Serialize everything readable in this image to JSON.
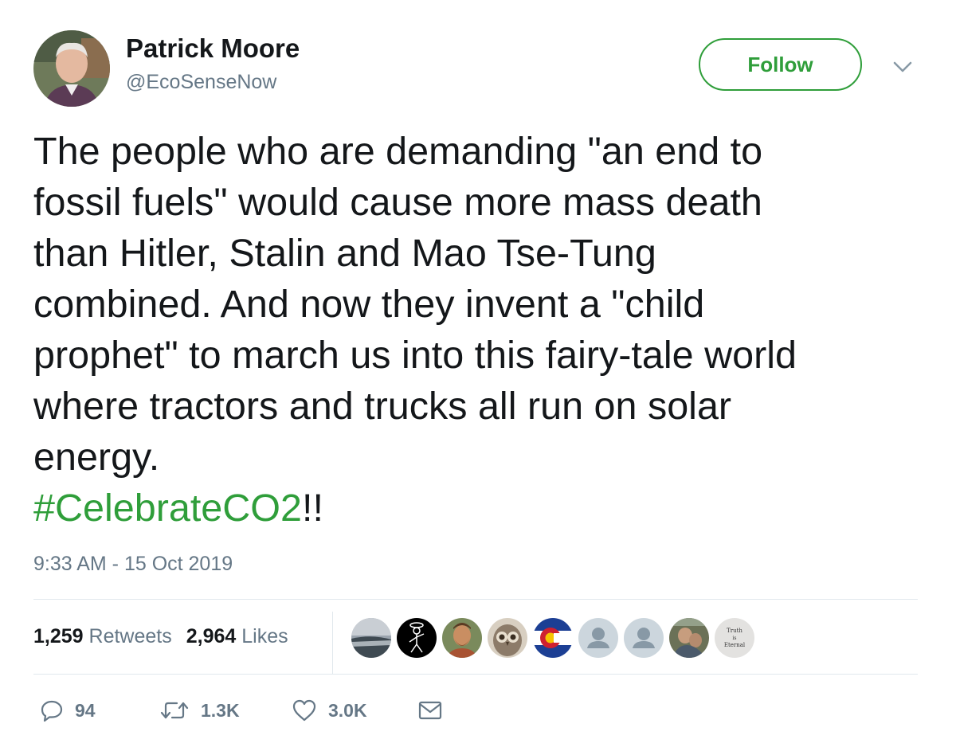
{
  "user": {
    "display_name": "Patrick Moore",
    "handle": "@EcoSenseNow",
    "avatar_icon": "profile-photo"
  },
  "follow_button": {
    "label": "Follow",
    "color": "#2f9e3a"
  },
  "menu_icon": "chevron-down-icon",
  "tweet": {
    "lines": [
      "The people who are demanding \"an end to",
      "fossil fuels\" would cause more mass death",
      "than Hitler, Stalin and Mao Tse-Tung",
      "combined. And now they invent a \"child",
      "prophet\" to march us into this fairy-tale world",
      "where tractors and trucks all run on solar",
      "energy."
    ],
    "hashtag": "#CelebrateCO2",
    "hashtag_suffix": "!!",
    "hashtag_color": "#2f9e3a"
  },
  "timestamp": "9:33 AM - 15 Oct 2019",
  "stats": {
    "retweets_count": "1,259",
    "retweets_label": "Retweets",
    "likes_count": "2,964",
    "likes_label": "Likes"
  },
  "likers": [
    {
      "icon": "landscape-avatar"
    },
    {
      "icon": "stick-figure-avatar"
    },
    {
      "icon": "bearded-man-avatar"
    },
    {
      "icon": "owl-avatar"
    },
    {
      "icon": "colorado-flag-avatar"
    },
    {
      "icon": "default-avatar"
    },
    {
      "icon": "default-avatar"
    },
    {
      "icon": "photo-avatar"
    },
    {
      "icon": "text-avatar",
      "text_line1": "Truth",
      "text_line2": "is",
      "text_line3": "Eternal"
    }
  ],
  "actions": {
    "replies": "94",
    "retweets": "1.3K",
    "likes": "3.0K"
  }
}
